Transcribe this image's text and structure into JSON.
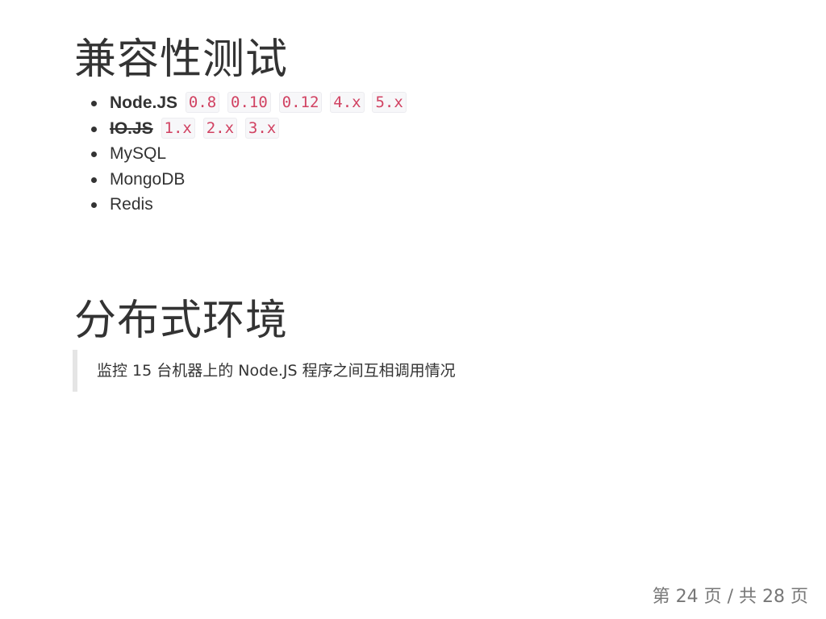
{
  "section1": {
    "title": "兼容性测试",
    "items": [
      {
        "label": "Node.JS",
        "style": "bold",
        "versions": [
          "0.8",
          "0.10",
          "0.12",
          "4.x",
          "5.x"
        ]
      },
      {
        "label": "IO.JS",
        "style": "bold-strikethrough",
        "versions": [
          "1.x",
          "2.x",
          "3.x"
        ]
      },
      {
        "label": "MySQL"
      },
      {
        "label": "MongoDB"
      },
      {
        "label": "Redis"
      }
    ]
  },
  "section2": {
    "title": "分布式环境",
    "quote": "监控 15 台机器上的 Node.JS 程序之间互相调用情况"
  },
  "footer": {
    "pagination": "第 24 页 / 共 28 页"
  },
  "colors": {
    "text": "#333333",
    "code_text": "#d14262",
    "code_bg": "#f7f7f9",
    "quote_border": "#e5e5e5",
    "footer_text": "#777777"
  }
}
